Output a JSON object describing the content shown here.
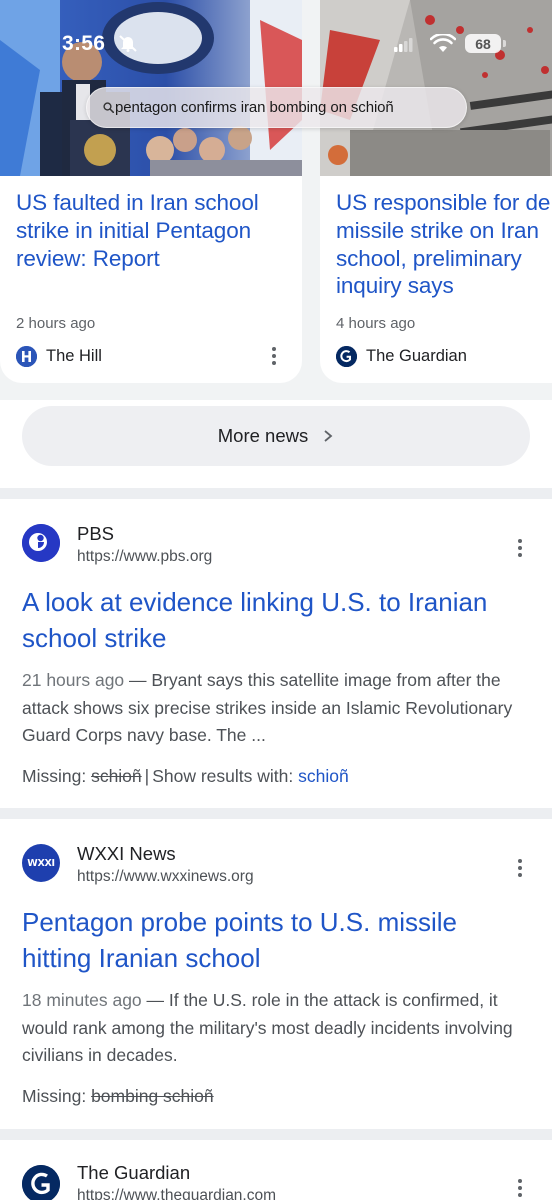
{
  "status_bar": {
    "time": "3:56",
    "battery": "68"
  },
  "search": {
    "query": "pentagon confirms iran bombing on schioñ"
  },
  "news_cards": [
    {
      "title": "US faulted in Iran school strike in initial Pentagon review: Report",
      "time": "2 hours ago",
      "source": "The Hill",
      "logo_letter": "H",
      "logo_color": "#2b55b8"
    },
    {
      "title_lines": [
        "US responsible for de",
        "missile strike on Iran",
        "school, preliminary",
        "inquiry says"
      ],
      "time": "4 hours ago",
      "source": "The Guardian",
      "logo_color": "#052962"
    }
  ],
  "more_news": {
    "label": "More news"
  },
  "results": [
    {
      "site_name": "PBS",
      "url": "https://www.pbs.org",
      "title": "A look at evidence linking U.S. to Iranian school strike",
      "date": "21 hours ago",
      "snippet": "Bryant says this satellite image from after the attack shows six precise strikes inside an Islamic Revolutionary Guard Corps navy base. The ...",
      "missing_label": "Missing:",
      "missing_terms": "schioñ",
      "show_results_label": "Show results with:",
      "show_results_term": "schioñ",
      "logo_color": "#2638c4"
    },
    {
      "site_name": "WXXI News",
      "url": "https://www.wxxinews.org",
      "title": "Pentagon probe points to U.S. missile hitting Iranian school",
      "date": "18 minutes ago",
      "snippet": "If the U.S. role in the attack is confirmed, it would rank among the military's most deadly incidents involving civilians in decades.",
      "missing_label": "Missing:",
      "missing_terms": "bombing schioñ",
      "logo_text": "WXXI",
      "logo_color": "#1e3fae"
    },
    {
      "site_name": "The Guardian",
      "url": "https://www.theguardian.com",
      "logo_color": "#052962"
    }
  ],
  "date_separator": "—"
}
